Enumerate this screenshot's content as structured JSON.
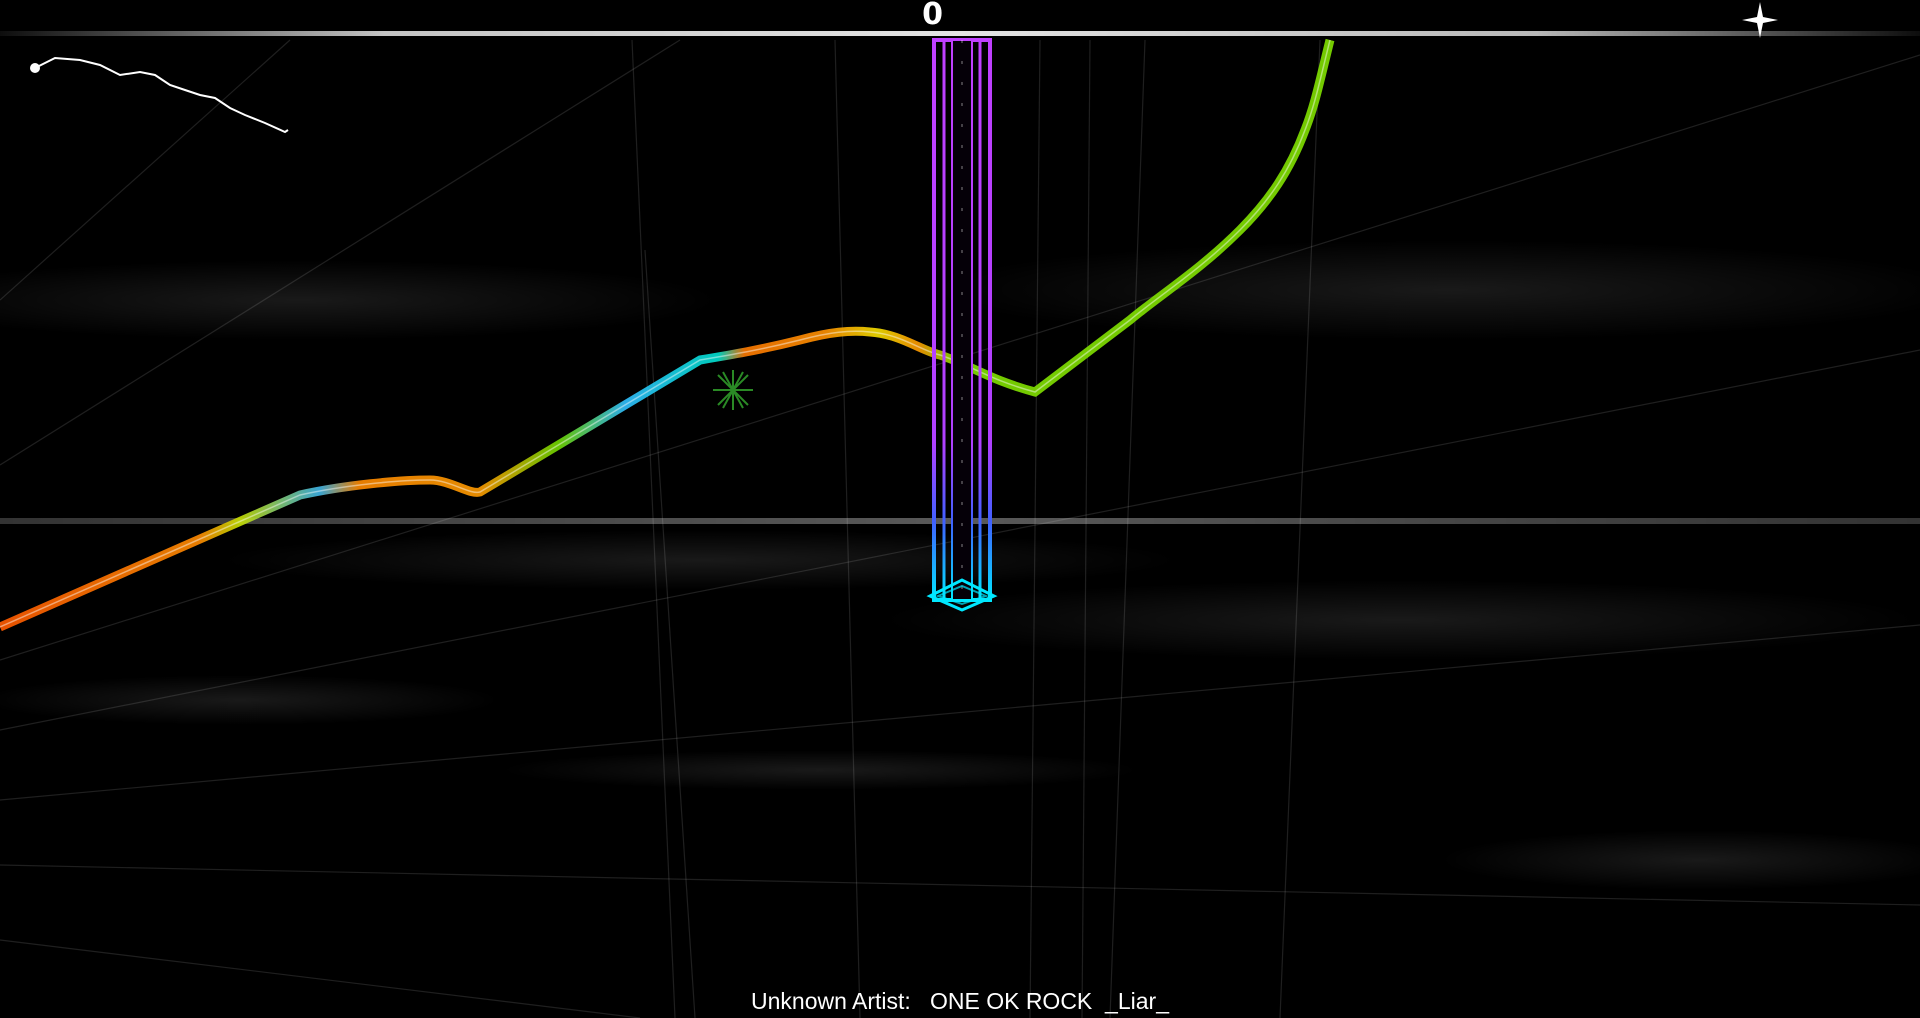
{
  "hud": {
    "score": "0",
    "progress": 0.49,
    "sparkle_icon": "four-point-star-icon"
  },
  "song": {
    "artist": "Unknown Artist:",
    "title": "ONE OK ROCK  _Liar_"
  },
  "colors": {
    "background": "#000000",
    "track_warm": "#ff8a00",
    "track_yellow": "#f2ff00",
    "track_green": "#5fdc00",
    "track_cyan": "#00d0e0",
    "tower_purple": "#c040ff",
    "tower_cyan": "#00e8ff"
  }
}
